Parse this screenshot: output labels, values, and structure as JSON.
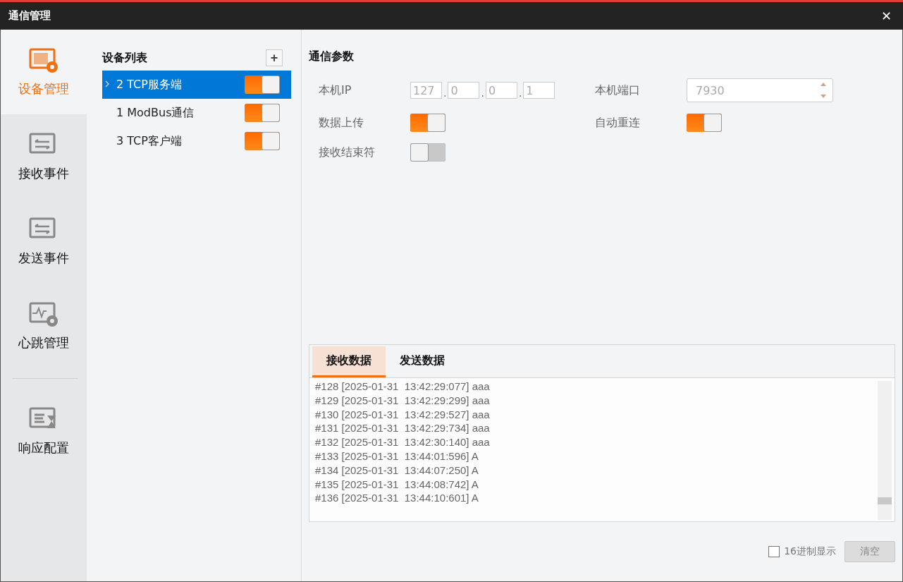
{
  "window": {
    "title": "通信管理",
    "close": "✕"
  },
  "nav": [
    {
      "label": "设备管理",
      "selected": true
    },
    {
      "label": "接收事件",
      "selected": false
    },
    {
      "label": "发送事件",
      "selected": false
    },
    {
      "label": "心跳管理",
      "selected": false
    },
    {
      "label": "响应配置",
      "selected": false
    }
  ],
  "device_list": {
    "title": "设备列表",
    "add": "+",
    "items": [
      {
        "label": "2 TCP服务端",
        "selected": true,
        "on": true
      },
      {
        "label": "1 ModBus通信",
        "selected": false,
        "on": true
      },
      {
        "label": "3 TCP客户端",
        "selected": false,
        "on": true
      }
    ]
  },
  "params": {
    "title": "通信参数",
    "ip": {
      "label": "本机IP",
      "parts": [
        "127",
        "0",
        "0",
        "1"
      ],
      "separator": "."
    },
    "port": {
      "label": "本机端口",
      "value": "7930"
    },
    "upload": {
      "label": "数据上传",
      "on": true
    },
    "reconnect": {
      "label": "自动重连",
      "on": true
    },
    "terminator": {
      "label": "接收结束符",
      "on": false
    }
  },
  "data_tabs": [
    {
      "label": "接收数据",
      "selected": true
    },
    {
      "label": "发送数据",
      "selected": false
    }
  ],
  "log": [
    "#128 [2025-01-31  13:42:29:077] aaa",
    "#129 [2025-01-31  13:42:29:299] aaa",
    "#130 [2025-01-31  13:42:29:527] aaa",
    "#131 [2025-01-31  13:42:29:734] aaa",
    "#132 [2025-01-31  13:42:30:140] aaa",
    "#133 [2025-01-31  13:44:01:596] A",
    "#134 [2025-01-31  13:44:07:250] A",
    "#135 [2025-01-31  13:44:08:742] A",
    "#136 [2025-01-31  13:44:10:601] A"
  ],
  "hex_display": {
    "label": "16进制显示",
    "checked": false
  },
  "clear_button": "清空"
}
